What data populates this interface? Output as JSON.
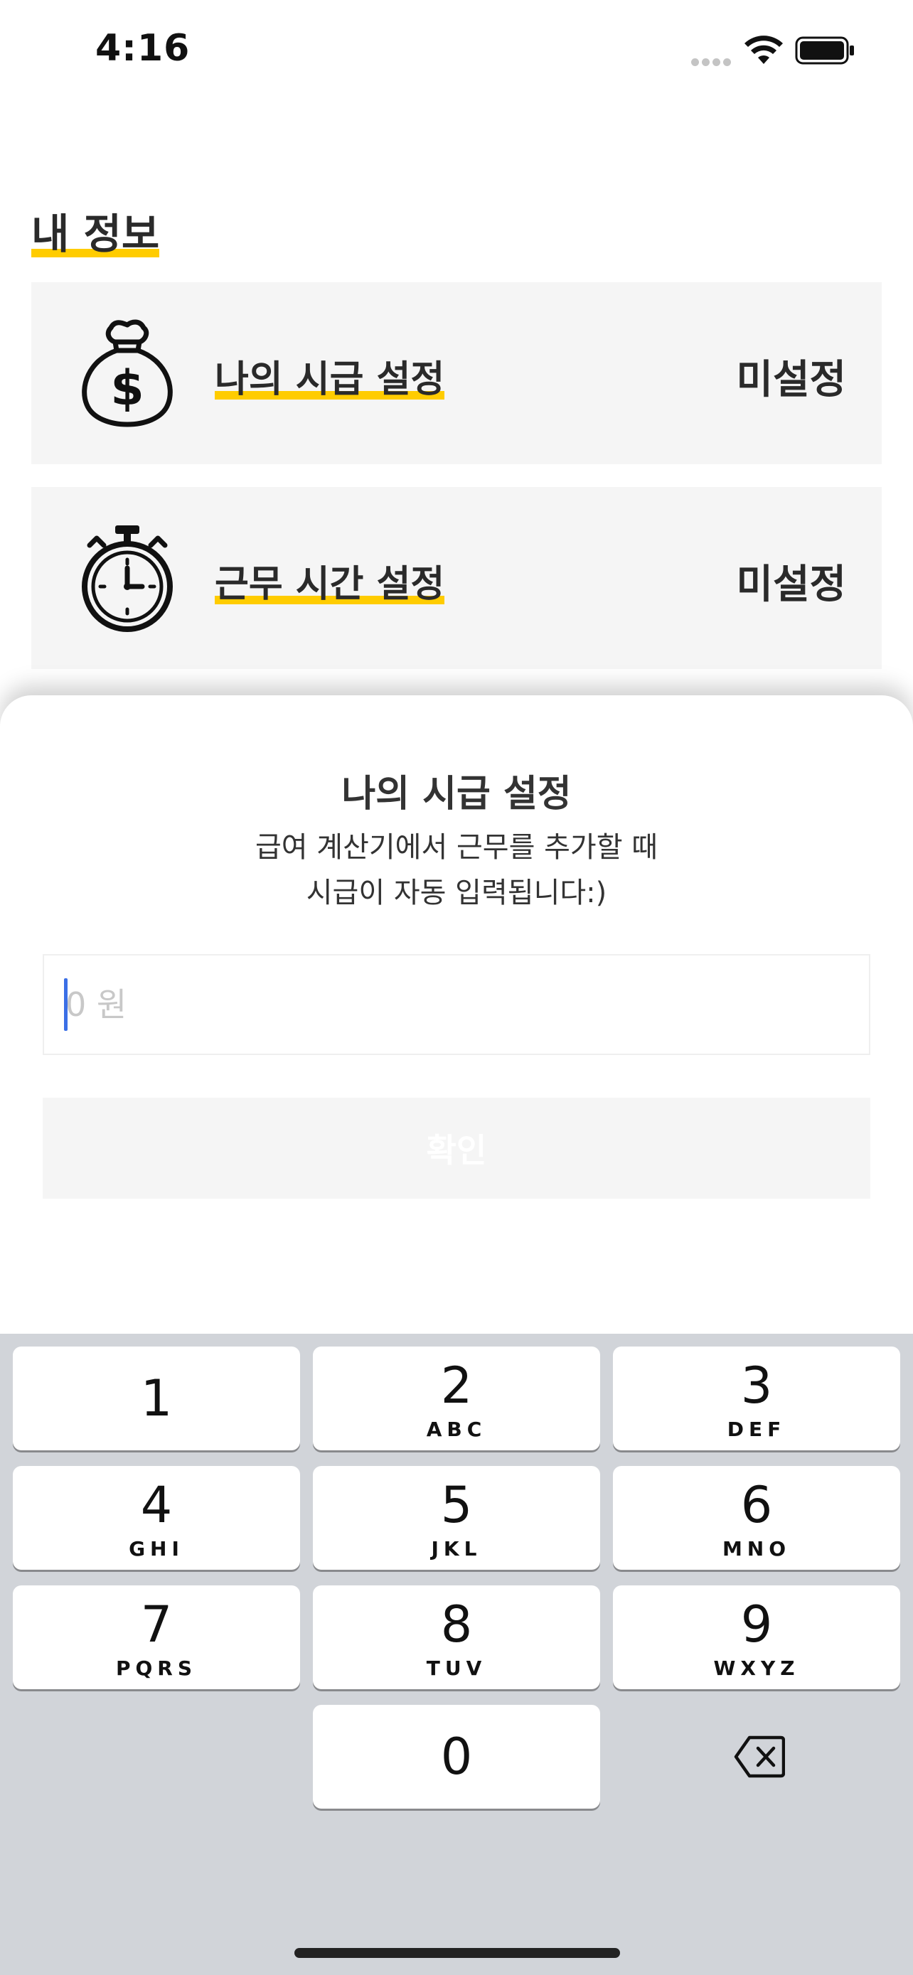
{
  "status_bar": {
    "time": "4:16"
  },
  "page": {
    "title": "내 정보"
  },
  "cards": [
    {
      "label": "나의 시급 설정",
      "status": "미설정",
      "icon": "money-bag-icon"
    },
    {
      "label": "근무 시간 설정",
      "status": "미설정",
      "icon": "stopwatch-icon"
    }
  ],
  "sheet": {
    "title": "나의 시급 설정",
    "desc_line1": "급여 계산기에서 근무를 추가할 때",
    "desc_line2": "시급이 자동 입력됩니다:)",
    "input_placeholder": "0 원",
    "confirm_label": "확인"
  },
  "keyboard": {
    "keys": [
      {
        "num": "1",
        "letters": ""
      },
      {
        "num": "2",
        "letters": "ABC"
      },
      {
        "num": "3",
        "letters": "DEF"
      },
      {
        "num": "4",
        "letters": "GHI"
      },
      {
        "num": "5",
        "letters": "JKL"
      },
      {
        "num": "6",
        "letters": "MNO"
      },
      {
        "num": "7",
        "letters": "PQRS"
      },
      {
        "num": "8",
        "letters": "TUV"
      },
      {
        "num": "9",
        "letters": "WXYZ"
      },
      {
        "num": "0",
        "letters": ""
      }
    ]
  },
  "colors": {
    "accent": "#FFCC00",
    "card_bg": "#F5F5F5",
    "keyboard_bg": "#D1D4D9",
    "caret": "#3B6FE6"
  }
}
